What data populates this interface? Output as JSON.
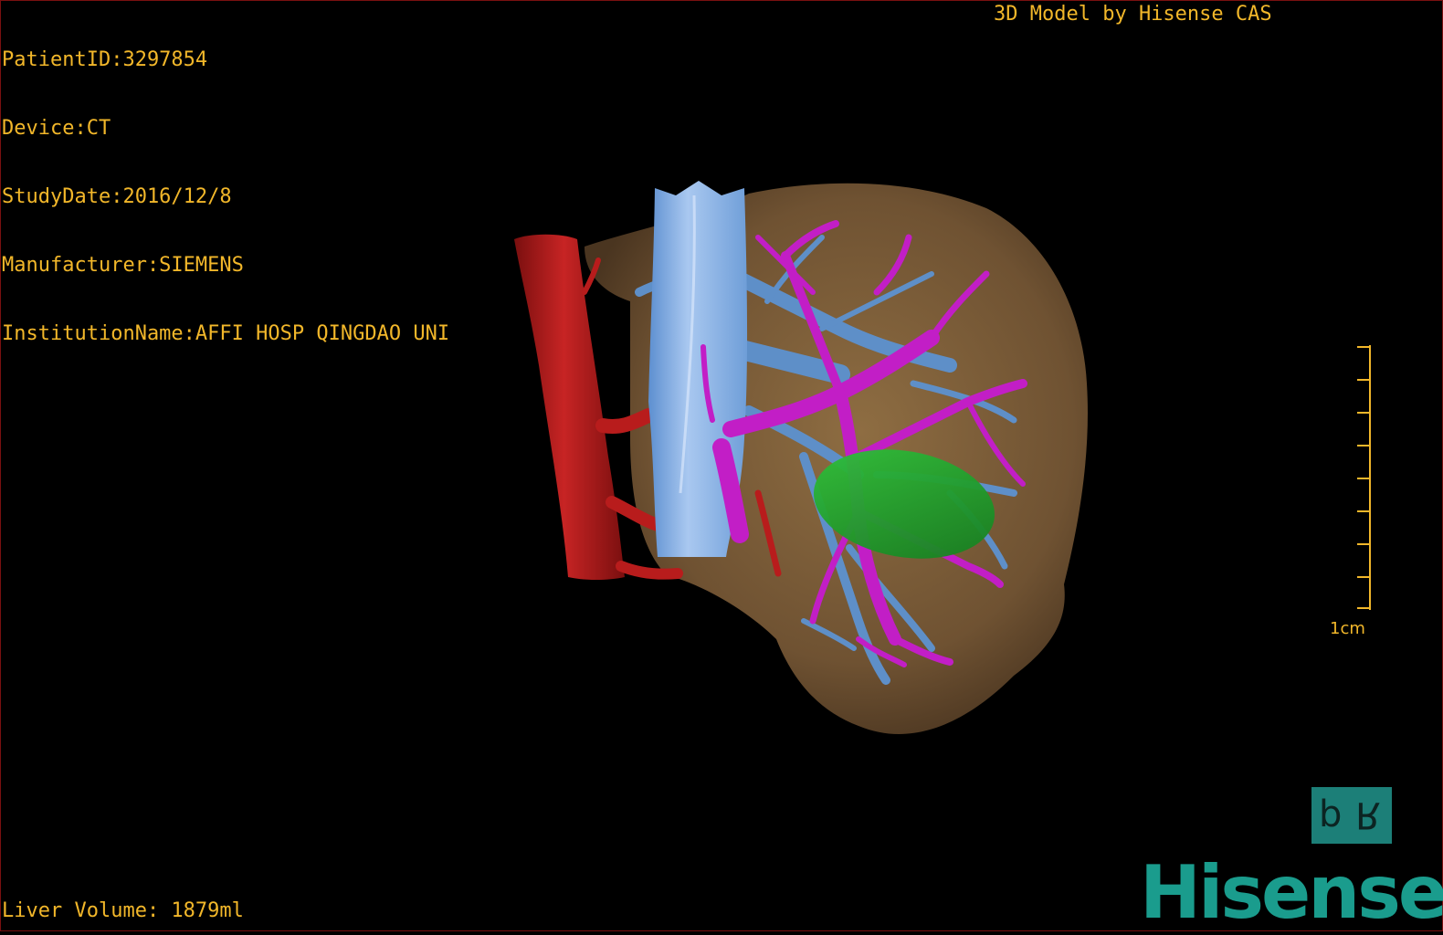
{
  "overlay": {
    "info_lines": [
      "PatientID:3297854",
      "Device:CT",
      "StudyDate:2016/12/8",
      "Manufacturer:SIEMENS",
      "InstitutionName:AFFI HOSP QINGDAO UNI"
    ],
    "credit": "3D Model by Hisense CAS",
    "liver_volume": "Liver Volume: 1879ml"
  },
  "scale_bar": {
    "label": "1cm"
  },
  "model": {
    "structures": [
      "liver",
      "aorta",
      "inferior-vena-cava",
      "portal-vein",
      "hepatic-vein",
      "lesion"
    ],
    "colors": {
      "liver": "#7a5c35",
      "aorta": "#b81c1c",
      "inferior_vena_cava": "#86b2e6",
      "hepatic_vein": "#5e8fc8",
      "portal_vein": "#c21ec6",
      "lesion": "#1fa52c"
    }
  },
  "branding": {
    "badge_left": "d",
    "badge_right": "R",
    "logo": "Hisense"
  },
  "theme": {
    "text_color": "#f2b72a",
    "brand_color": "#1a9c8d",
    "border_color": "#7a1010"
  }
}
